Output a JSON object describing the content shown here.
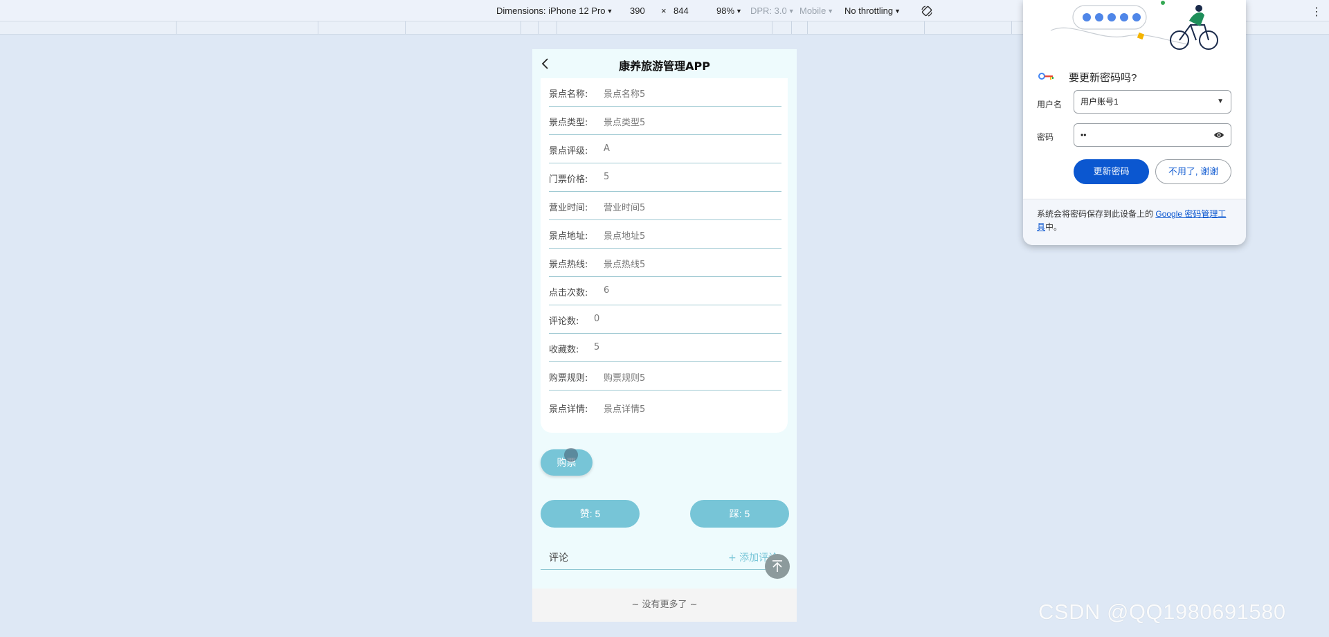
{
  "devtools": {
    "dimensions_label": "Dimensions: iPhone 12 Pro",
    "width": "390",
    "times": "×",
    "height": "844",
    "zoom": "98%",
    "dpr": "DPR: 3.0",
    "mode": "Mobile",
    "throttling": "No throttling"
  },
  "app": {
    "title": "康养旅游管理APP",
    "fields": [
      {
        "label": "景点名称:",
        "value": "景点名称5"
      },
      {
        "label": "景点类型:",
        "value": "景点类型5"
      },
      {
        "label": "景点评级:",
        "value": "A"
      },
      {
        "label": "门票价格:",
        "value": "5"
      },
      {
        "label": "营业时间:",
        "value": "营业时间5"
      },
      {
        "label": "景点地址:",
        "value": "景点地址5"
      },
      {
        "label": "景点热线:",
        "value": "景点热线5"
      },
      {
        "label": "点击次数:",
        "value": "6"
      },
      {
        "label": "评论数:",
        "value": "0"
      },
      {
        "label": "收藏数:",
        "value": "5"
      },
      {
        "label": "购票规则:",
        "value": "购票规则5"
      },
      {
        "label": "景点详情:",
        "value": "景点详情5"
      }
    ],
    "buy_label": "购票",
    "like_label": "赞: 5",
    "dislike_label": "踩: 5",
    "comment_title": "评论",
    "add_comment_label": "+ 添加评论",
    "footer_text": "~ 没有更多了 ~"
  },
  "password_popup": {
    "title": "要更新密码吗?",
    "username_label": "用户名",
    "username_value": "用户账号1",
    "password_label": "密码",
    "password_value": "••",
    "update_label": "更新密码",
    "no_thanks_label": "不用了, 谢谢",
    "footer_text": "系统会将密码保存到此设备上的",
    "footer_link": "Google 密码管理工具",
    "footer_suffix": "中。"
  },
  "watermark": "CSDN @QQ1980691580",
  "colors": {
    "accent": "#77c5d7",
    "page_bg": "#eefbfd",
    "google_blue": "#0b57d0"
  }
}
